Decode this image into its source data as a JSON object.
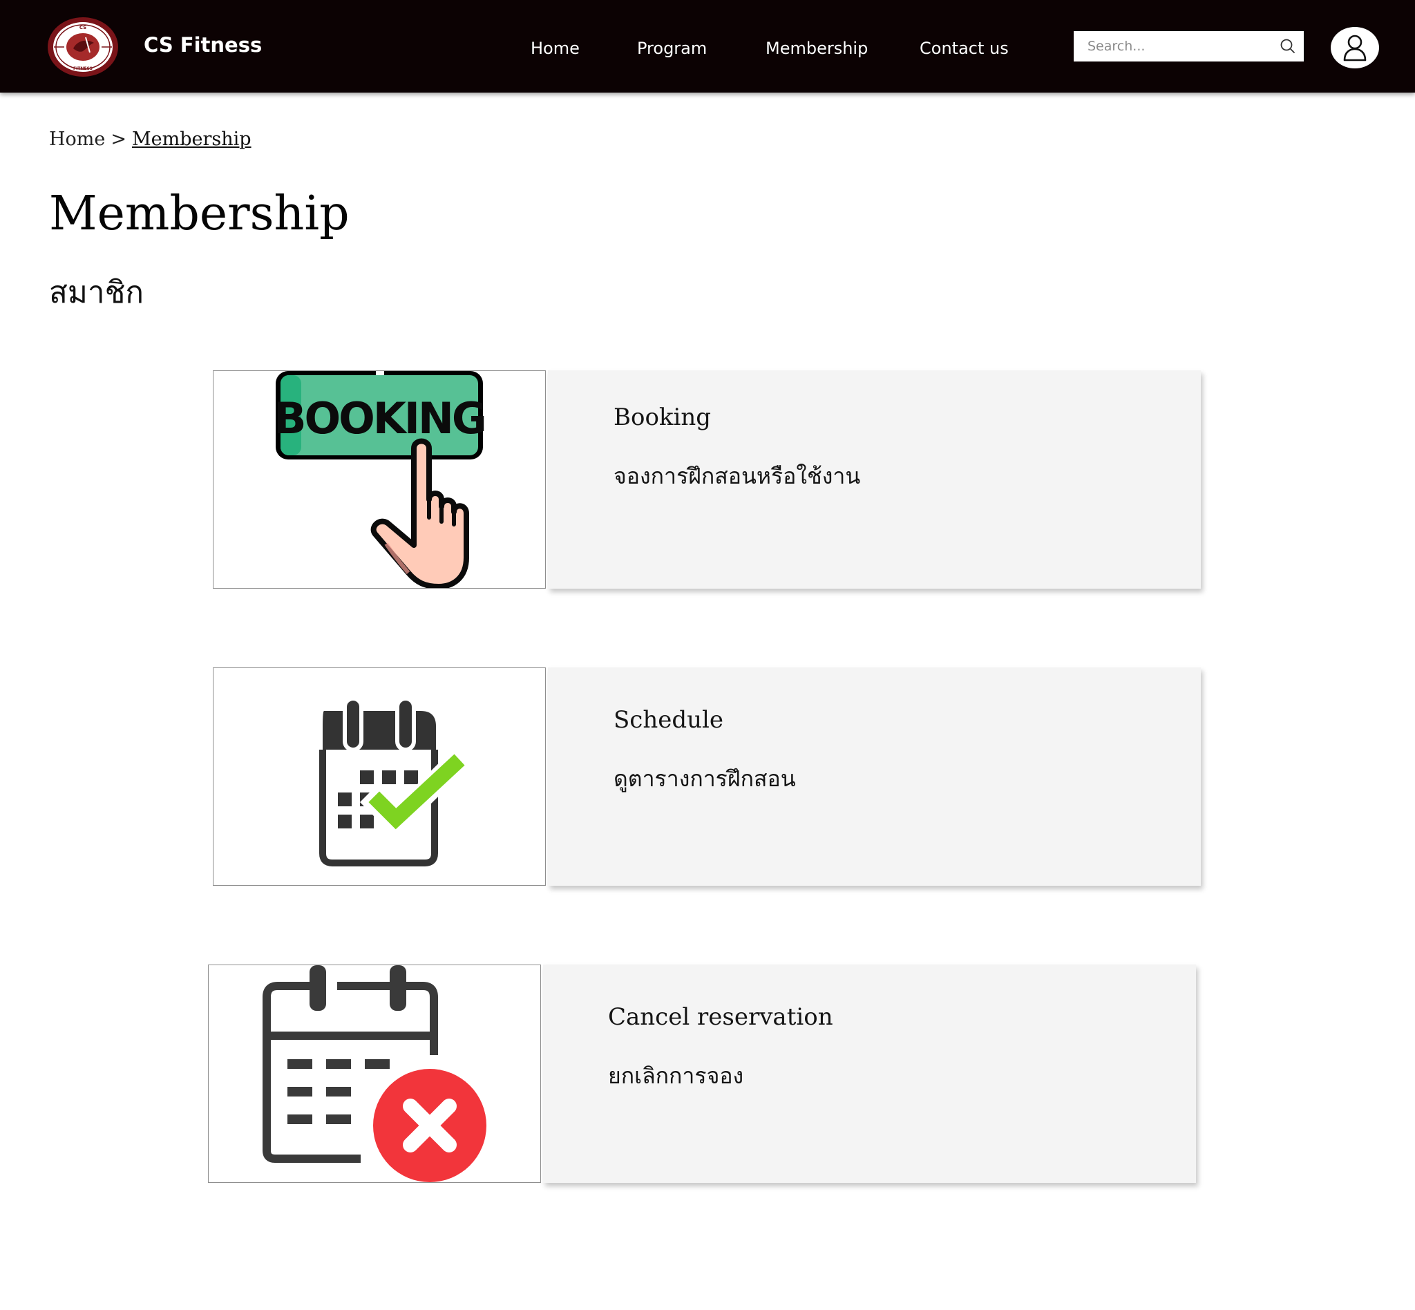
{
  "header": {
    "brand": "CS Fitness",
    "logo_text_top": "CS",
    "logo_text_bottom": "FITNESS",
    "nav": [
      "Home",
      "Program",
      "Membership",
      "Contact us"
    ],
    "search_placeholder": "Search..."
  },
  "breadcrumb": {
    "home": "Home",
    "separator": ">",
    "current": "Membership"
  },
  "page": {
    "title": "Membership",
    "subtitle": "สมาชิก"
  },
  "cards": [
    {
      "title": "Booking",
      "description": "จองการฝึกสอนหรือใช้งาน",
      "image_text": "BOOKING",
      "icon": "booking-hand-icon"
    },
    {
      "title": "Schedule",
      "description": "ดูตารางการฝึกสอน",
      "icon": "calendar-check-icon"
    },
    {
      "title": "Cancel reservation",
      "description": "ยกเลิกการจอง",
      "icon": "calendar-cancel-icon"
    }
  ],
  "colors": {
    "header_bg": "#0c0203",
    "card_bg": "#f4f4f4",
    "booking_green": "#57c195",
    "check_green": "#7ed321",
    "cancel_red": "#f2353b",
    "logo_red": "#8c1a1f"
  }
}
